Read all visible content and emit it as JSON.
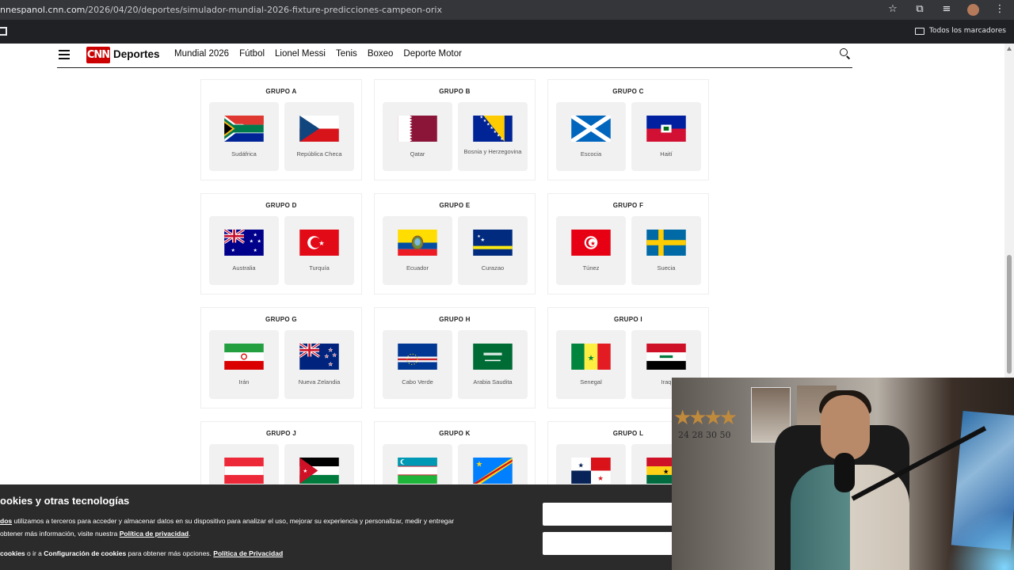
{
  "browser": {
    "url_domain": "nnespanol.cnn.com",
    "url_path": "/2026/04/20/deportes/simulador-mundial-2026-fixture-predicciones-campeon-orix",
    "bookmarks_all": "Todos los marcadores"
  },
  "header": {
    "logo": "CNN",
    "brand": "Deportes",
    "nav": [
      "Mundial 2026",
      "Fútbol",
      "Lionel Messi",
      "Tenis",
      "Boxeo",
      "Deporte Motor"
    ]
  },
  "groups": [
    {
      "title": "GRUPO A",
      "teams": [
        {
          "name": "Sudáfrica",
          "flag": "south-africa"
        },
        {
          "name": "República Checa",
          "flag": "czechia"
        }
      ]
    },
    {
      "title": "GRUPO B",
      "teams": [
        {
          "name": "Qatar",
          "flag": "qatar"
        },
        {
          "name": "Bosnia y Herzegovina",
          "flag": "bosnia"
        }
      ]
    },
    {
      "title": "GRUPO C",
      "teams": [
        {
          "name": "Escocia",
          "flag": "scotland"
        },
        {
          "name": "Haití",
          "flag": "haiti"
        }
      ]
    },
    {
      "title": "GRUPO D",
      "teams": [
        {
          "name": "Australia",
          "flag": "australia"
        },
        {
          "name": "Turquía",
          "flag": "turkey"
        }
      ]
    },
    {
      "title": "GRUPO E",
      "teams": [
        {
          "name": "Ecuador",
          "flag": "ecuador"
        },
        {
          "name": "Curazao",
          "flag": "curacao"
        }
      ]
    },
    {
      "title": "GRUPO F",
      "teams": [
        {
          "name": "Túnez",
          "flag": "tunisia"
        },
        {
          "name": "Suecia",
          "flag": "sweden"
        }
      ]
    },
    {
      "title": "GRUPO G",
      "teams": [
        {
          "name": "Irán",
          "flag": "iran"
        },
        {
          "name": "Nueva Zelandia",
          "flag": "new-zealand"
        }
      ]
    },
    {
      "title": "GRUPO H",
      "teams": [
        {
          "name": "Cabo Verde",
          "flag": "cape-verde"
        },
        {
          "name": "Arabia Saudita",
          "flag": "saudi-arabia"
        }
      ]
    },
    {
      "title": "GRUPO I",
      "teams": [
        {
          "name": "Senegal",
          "flag": "senegal"
        },
        {
          "name": "Iraq",
          "flag": "iraq"
        }
      ]
    },
    {
      "title": "GRUPO J",
      "teams": [
        {
          "name": "",
          "flag": "austria"
        },
        {
          "name": "",
          "flag": "jordan"
        }
      ]
    },
    {
      "title": "GRUPO K",
      "teams": [
        {
          "name": "",
          "flag": "uzbekistan"
        },
        {
          "name": "",
          "flag": "dr-congo"
        }
      ]
    },
    {
      "title": "GRUPO L",
      "teams": [
        {
          "name": "",
          "flag": "panama"
        },
        {
          "name": "",
          "flag": "ghana"
        }
      ]
    }
  ],
  "cookie": {
    "title": "ookies y otras tecnologías",
    "line1_link": "dos",
    "line1": " utilizamos a terceros para acceder y almacenar datos en su dispositivo para analizar el uso, mejorar su experiencia y personalizar, medir y entregar",
    "line2_pre": " obtener más información, visite nuestra ",
    "line2_link": "Política de privacidad",
    "line2_post": ".",
    "line3_a": "cookies",
    "line3_b": " o ir a ",
    "line3_c": "Configuración de cookies",
    "line3_d": " para obtener más opciones. ",
    "line3_link": "Política de Privacidad"
  },
  "webcam": {
    "stars_numbers": "24  28  30  50"
  }
}
